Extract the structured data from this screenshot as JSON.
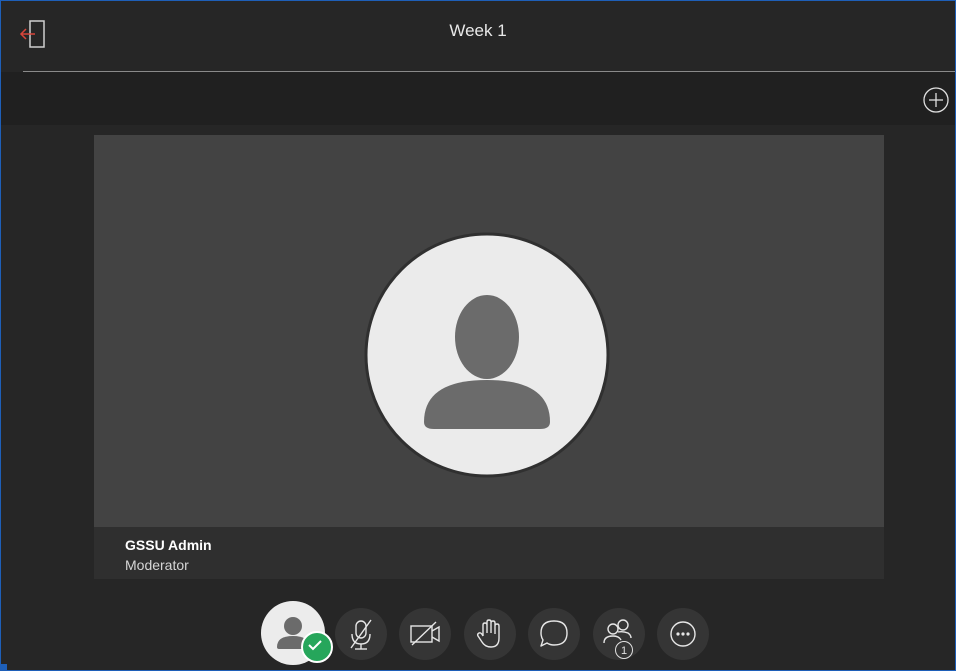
{
  "header": {
    "title": "Week 1"
  },
  "tile": {
    "name": "GSSU Admin",
    "role": "Moderator"
  },
  "controls": {
    "participant_count": "1"
  },
  "colors": {
    "accent_leave": "#d9453a",
    "status_ok": "#26a65b",
    "background": "#262626",
    "video_bg": "#434343"
  },
  "icons": [
    "leave-session-icon",
    "add-icon",
    "microphone-muted-icon",
    "camera-off-icon",
    "raise-hand-icon",
    "chat-icon",
    "participants-icon",
    "more-options-icon",
    "check-icon",
    "avatar-icon"
  ]
}
